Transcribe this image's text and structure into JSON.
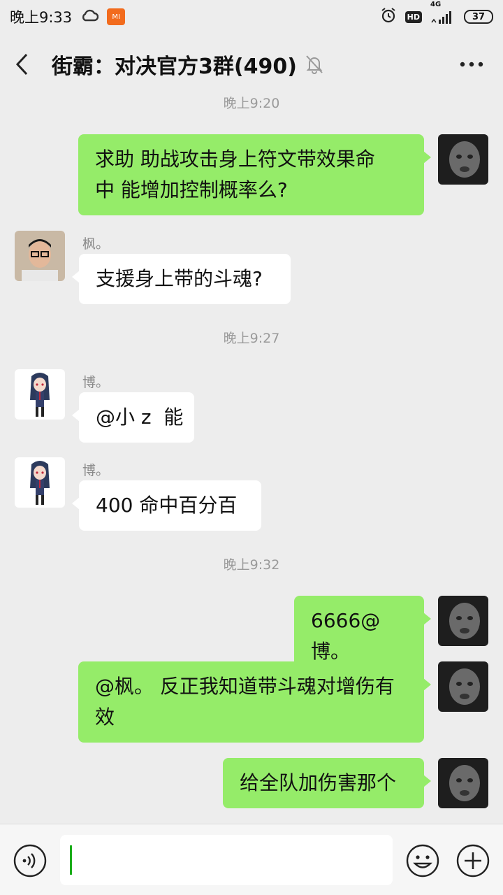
{
  "status_bar": {
    "time": "晚上9:33",
    "network": "4G",
    "hd_label": "HD",
    "battery": "37",
    "mi_label": "MI"
  },
  "header": {
    "title": "街霸：对决官方3群(490)"
  },
  "messages": [
    {
      "type": "time",
      "text": "晚上9:20"
    },
    {
      "type": "msg",
      "side": "me",
      "lines": [
        "求助 助战攻击身上符文带效果命",
        "中 能增加控制概率么?"
      ]
    },
    {
      "type": "msg",
      "side": "other",
      "sender": "枫。",
      "lines": [
        "支援身上带的斗魂?"
      ]
    },
    {
      "type": "time",
      "text": "晚上9:27"
    },
    {
      "type": "msg",
      "side": "other",
      "sender": "博。",
      "lines": [
        "@小 z  能"
      ]
    },
    {
      "type": "msg",
      "side": "other",
      "sender": "博。",
      "lines": [
        "400 命中百分百"
      ]
    },
    {
      "type": "time",
      "text": "晚上9:32"
    },
    {
      "type": "msg",
      "side": "me",
      "lines": [
        "6666@博。"
      ]
    },
    {
      "type": "msg",
      "side": "me",
      "lines": [
        "@枫。 反正我知道带斗魂对增伤有",
        "效"
      ]
    },
    {
      "type": "msg",
      "side": "me",
      "lines": [
        "给全队加伤害那个"
      ]
    }
  ],
  "input_bar": {
    "placeholder": ""
  },
  "colors": {
    "background": "#ededed",
    "my_bubble": "#95ec69",
    "other_bubble": "#ffffff",
    "timestamp": "#9a9a9a",
    "accent": "#1aad19"
  }
}
